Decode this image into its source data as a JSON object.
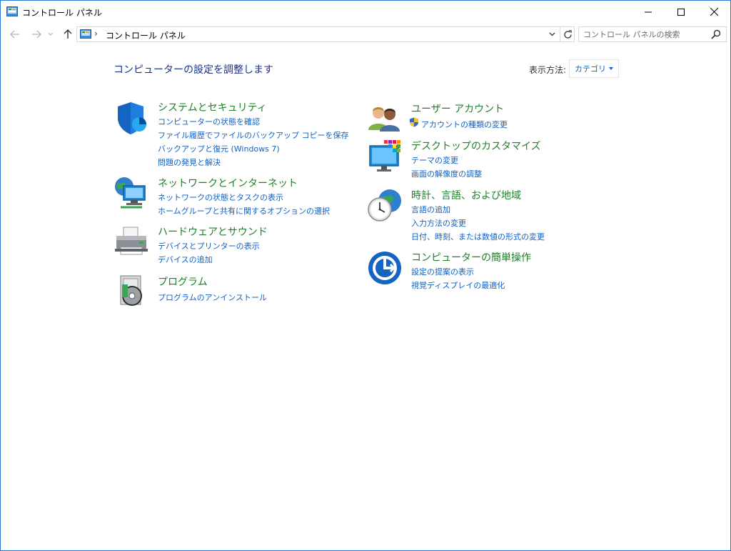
{
  "window": {
    "title": "コントロール パネル",
    "minimize_icon": "minimize-icon",
    "maximize_icon": "maximize-icon",
    "close_icon": "close-icon"
  },
  "nav": {
    "back_icon": "arrow-left-icon",
    "forward_icon": "arrow-right-icon",
    "recent_icon": "chevron-down-icon",
    "up_icon": "arrow-up-icon",
    "address_separator": "›",
    "address_text": "コントロール パネル",
    "search_placeholder": "コントロール パネルの検索"
  },
  "content": {
    "heading": "コンピューターの設定を調整します",
    "view_by_label": "表示方法:",
    "view_by_value": "カテゴリ"
  },
  "categories": [
    {
      "title": "システムとセキュリティ",
      "icon": "shield-icon",
      "links": [
        "コンピューターの状態を確認",
        "ファイル履歴でファイルのバックアップ コピーを保存",
        "バックアップと復元 (Windows 7)",
        "問題の発見と解決"
      ]
    },
    {
      "title": "ネットワークとインターネット",
      "icon": "network-icon",
      "links": [
        "ネットワークの状態とタスクの表示",
        "ホームグループと共有に関するオプションの選択"
      ]
    },
    {
      "title": "ハードウェアとサウンド",
      "icon": "printer-icon",
      "links": [
        "デバイスとプリンターの表示",
        "デバイスの追加"
      ]
    },
    {
      "title": "プログラム",
      "icon": "programs-icon",
      "links": [
        "プログラムのアンインストール"
      ]
    },
    {
      "title": "ユーザー アカウント",
      "icon": "users-icon",
      "links": [
        "アカウントの種類の変更"
      ]
    },
    {
      "title": "デスクトップのカスタマイズ",
      "icon": "desktop-icon",
      "links": [
        "テーマの変更",
        "画面の解像度の調整"
      ]
    },
    {
      "title": "時計、言語、および地域",
      "icon": "clock-globe-icon",
      "links": [
        "言語の追加",
        "入力方法の変更",
        "日付、時刻、または数値の形式の変更"
      ]
    },
    {
      "title": "コンピューターの簡単操作",
      "icon": "ease-of-access-icon",
      "links": [
        "設定の提案の表示",
        "視覚ディスプレイの最適化"
      ]
    }
  ],
  "colors": {
    "heading": "#1e3287",
    "category_title": "#217f2b",
    "link": "#0e62c7",
    "window_border": "#2b79d8"
  }
}
